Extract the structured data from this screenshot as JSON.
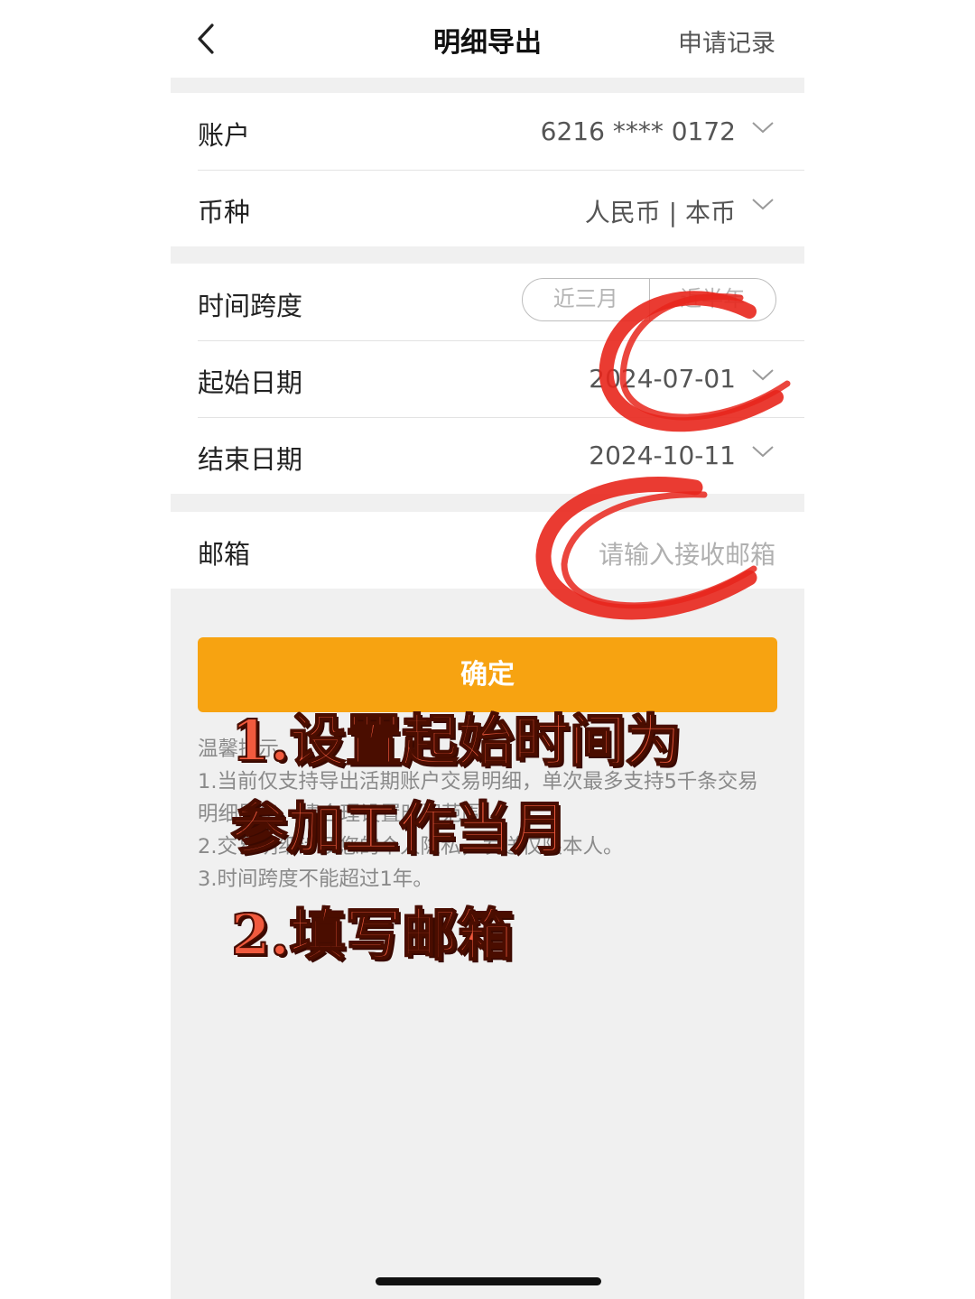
{
  "nav": {
    "title": "明细导出",
    "right_link": "申请记录"
  },
  "account": {
    "label": "账户",
    "value": "6216 **** 0172"
  },
  "currency": {
    "label": "币种",
    "value": "人民币 | 本币"
  },
  "time_span": {
    "label": "时间跨度",
    "options": [
      "近三月",
      "近半年"
    ]
  },
  "start_date": {
    "label": "起始日期",
    "value": "2024-07-01"
  },
  "end_date": {
    "label": "结束日期",
    "value": "2024-10-11"
  },
  "email": {
    "label": "邮箱",
    "placeholder": "请输入接收邮箱"
  },
  "confirm_label": "确定",
  "tips": {
    "title": "温馨提示",
    "lines": [
      "1.当前仅支持导出活期账户交易明细，单次最多支持5千条交易明细导出，请合理设置时间范围。",
      "2.交易明细涉及您的个人隐私，发送仅限本人。",
      "3.时间跨度不能超过1年。"
    ]
  },
  "annotations": {
    "line1": "1.设置起始时间为",
    "line2": "参加工作当月",
    "line3": "2.填写邮箱"
  },
  "colors": {
    "accent": "#f7a311",
    "annotation": "#f15a3e",
    "scribble": "#e8261c"
  }
}
